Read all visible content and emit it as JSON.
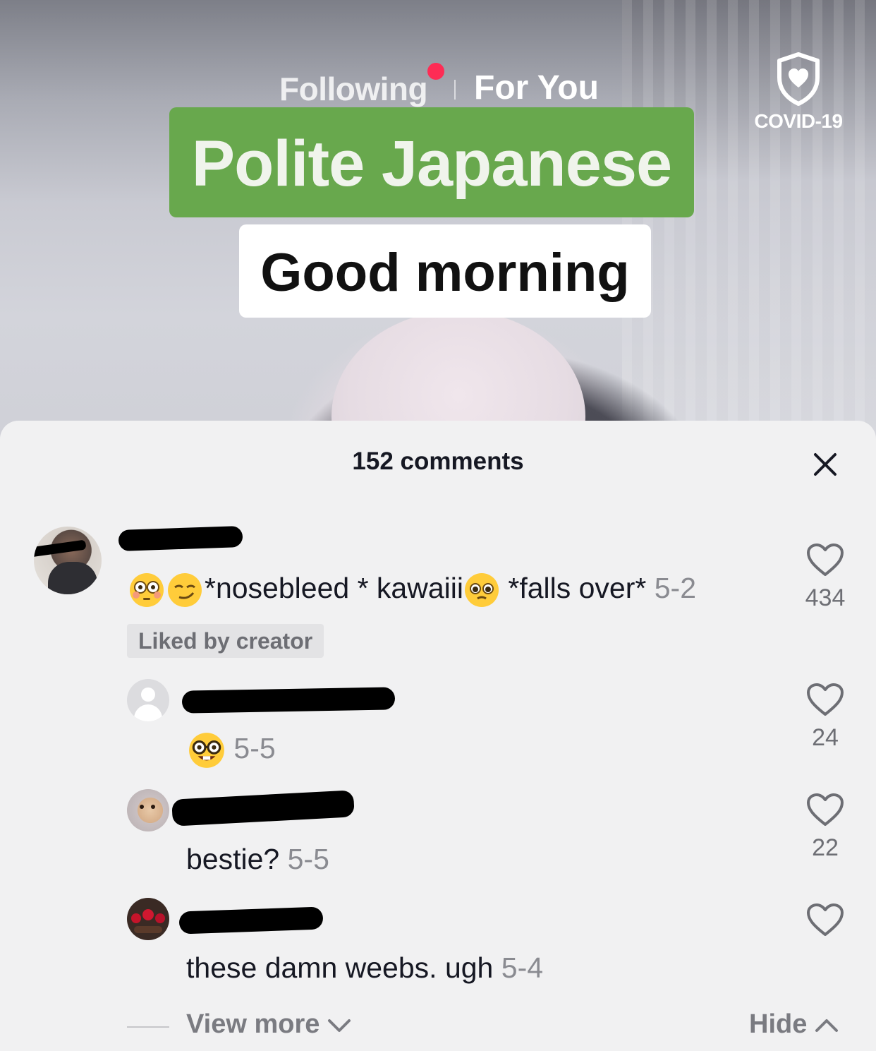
{
  "header": {
    "tab_following": "Following",
    "tab_foryou": "For You",
    "covid_label": "COVID-19"
  },
  "video": {
    "caption_line1": "Polite Japanese",
    "caption_line2": "Good morning"
  },
  "comments_sheet": {
    "title": "152 comments",
    "comments": [
      {
        "text": "*nosebleed * kawaiii",
        "text_tail": " *falls over*",
        "date": "5-2",
        "badge": "Liked by creator",
        "likes": "434"
      },
      {
        "date": "5-5",
        "likes": "24"
      },
      {
        "text": "bestie?",
        "date": "5-5",
        "likes": "22"
      },
      {
        "text": "these damn weebs. ugh",
        "date": "5-4"
      }
    ],
    "view_more": "View more",
    "hide": "Hide"
  },
  "icons": [
    "live-indicator-dot",
    "covid-shield-icon",
    "close-icon",
    "heart-icon",
    "chevron-down-icon",
    "chevron-up-icon",
    "flushed-emoji",
    "smirk-emoji",
    "pleading-emoji",
    "nerd-emoji"
  ],
  "colors": {
    "live_dot": "#fe2c55",
    "caption_green": "#68a84d",
    "sheet_bg": "#f1f1f2",
    "text_primary": "#161823",
    "text_secondary": "#8a8b91"
  }
}
